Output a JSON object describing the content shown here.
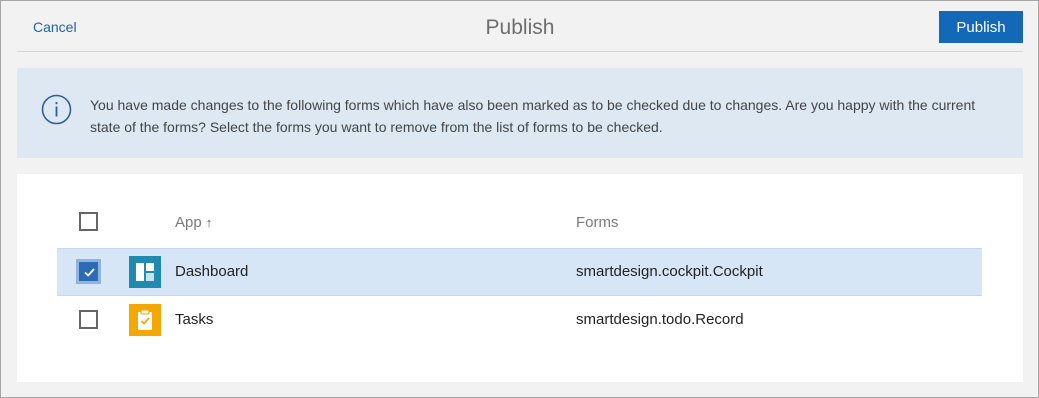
{
  "header": {
    "cancel_label": "Cancel",
    "title": "Publish",
    "publish_label": "Publish"
  },
  "info": {
    "icon": "info-circle-icon",
    "message": "You have made changes to the following forms which have also been marked as to be checked due to changes. Are you happy with the current state of the forms? Select the forms you want to remove from the list of forms to be checked."
  },
  "table": {
    "select_all_checked": false,
    "columns": {
      "app": "App",
      "app_sort_icon": "↑",
      "forms": "Forms"
    },
    "rows": [
      {
        "checked": true,
        "icon": "dashboard-app-icon",
        "app": "Dashboard",
        "forms": "smartdesign.cockpit.Cockpit"
      },
      {
        "checked": false,
        "icon": "tasks-app-icon",
        "app": "Tasks",
        "forms": "smartdesign.todo.Record"
      }
    ]
  },
  "colors": {
    "accent": "#1468b8",
    "link": "#1e63ad",
    "info_bg": "#dde8f3",
    "selected_row": "#d6e6f6",
    "dashboard_icon": "#1f8bb0",
    "tasks_icon": "#f2a800"
  }
}
